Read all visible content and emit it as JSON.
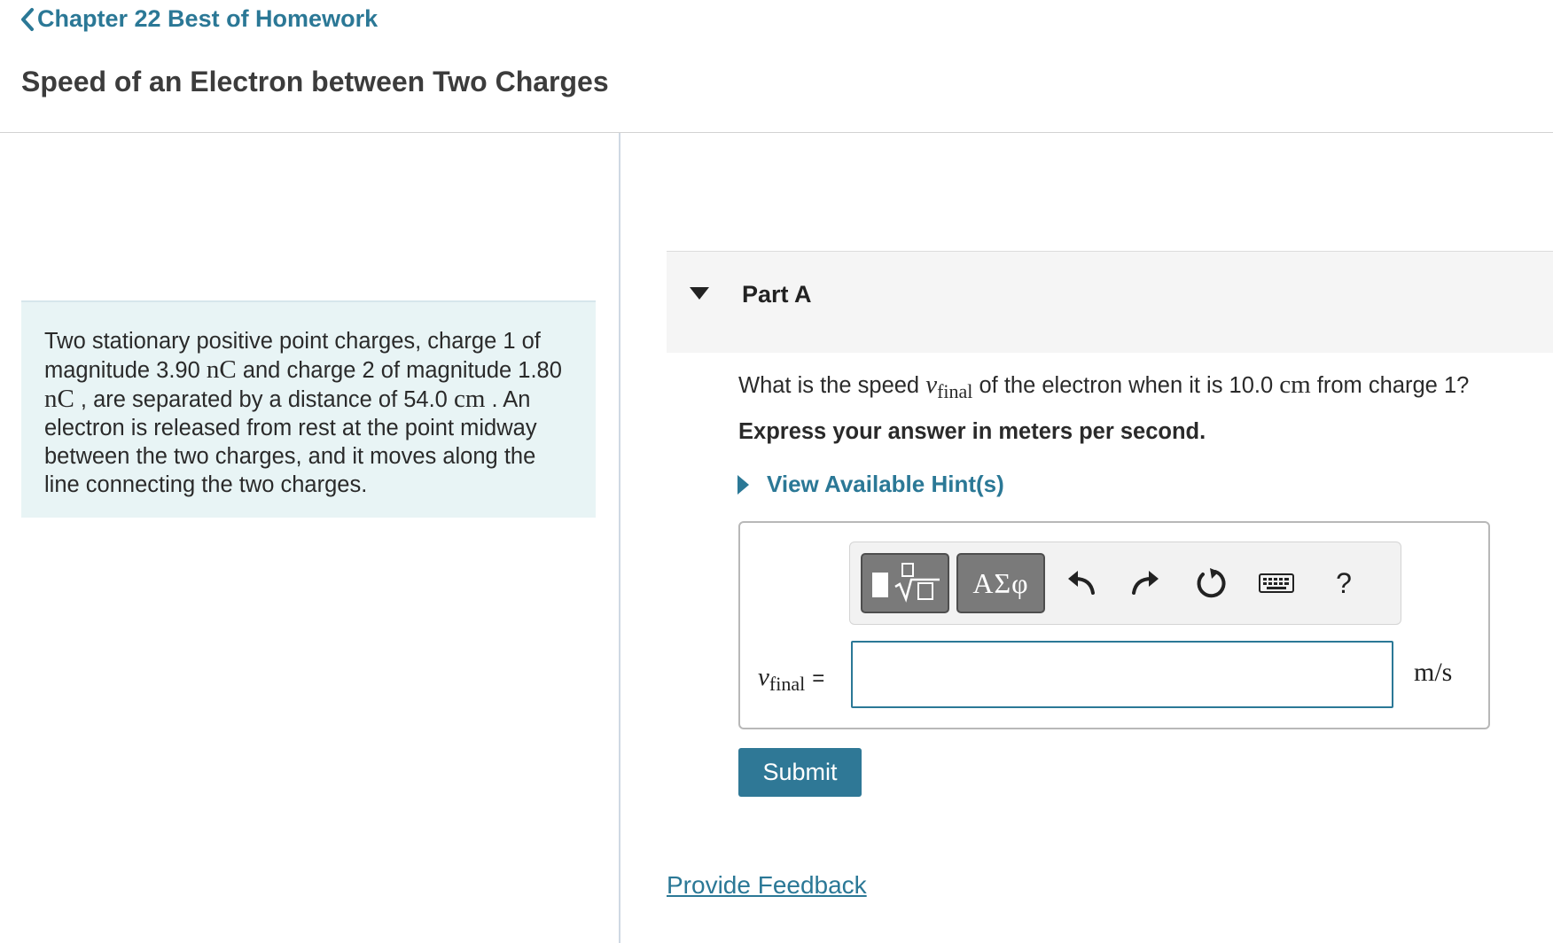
{
  "breadcrumb": {
    "label": "Chapter 22 Best of Homework"
  },
  "page": {
    "title": "Speed of an Electron between Two Charges"
  },
  "intro": {
    "t1": "Two stationary positive point charges, charge 1 of magnitude 3.90 ",
    "u1": "nC",
    "t2": " and charge 2 of magnitude 1.80 ",
    "u2": "nC",
    "t3": " , are separated by a distance of 54.0 ",
    "u3": "cm",
    "t4": " . An electron is released from rest at the point midway between the two charges, and it moves along the line connecting the two charges."
  },
  "part": {
    "label": "Part A"
  },
  "question": {
    "prefix": "What is the speed ",
    "var": "v",
    "sub": "final",
    "middle": " of the electron when it is 10.0 ",
    "unit": "cm",
    "suffix": " from charge 1?"
  },
  "instruction": "Express your answer in meters per second.",
  "hint": {
    "label": "View Available Hint(s)"
  },
  "toolbar": {
    "templates_icon": "templates-sqrt-icon",
    "greek_label": "ΑΣφ",
    "undo_icon": "undo-icon",
    "redo_icon": "redo-icon",
    "reset_icon": "reset-icon",
    "keyboard_icon": "keyboard-icon",
    "help_label": "?"
  },
  "answer": {
    "var": "v",
    "sub": "final",
    "equals": "=",
    "value": "",
    "units": "m/s"
  },
  "submit": {
    "label": "Submit"
  },
  "feedback": {
    "label": "Provide Feedback"
  },
  "colors": {
    "accent": "#2b7896",
    "intro_bg": "#e8f4f5",
    "button_bg": "#2f7896"
  }
}
